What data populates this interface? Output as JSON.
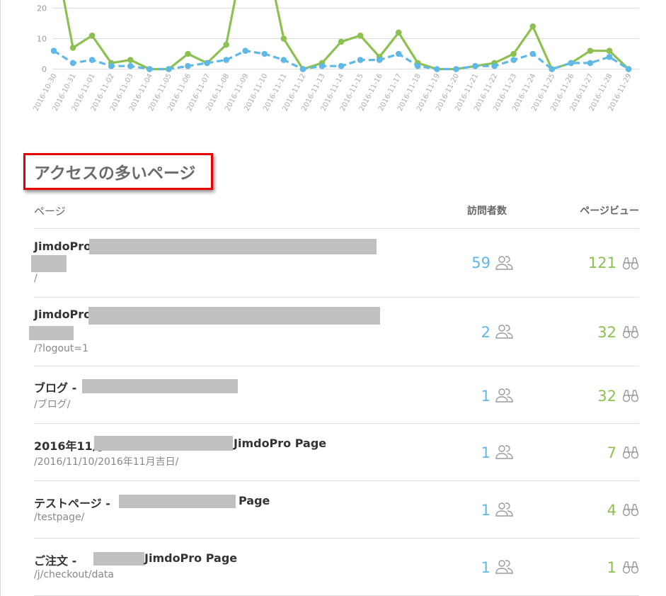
{
  "chart_data": {
    "type": "line",
    "categories": [
      "2016-10-30",
      "2016-10-31",
      "2016-11-01",
      "2016-11-02",
      "2016-11-03",
      "2016-11-04",
      "2016-11-05",
      "2016-11-06",
      "2016-11-07",
      "2016-11-08",
      "2016-11-09",
      "2016-11-10",
      "2016-11-11",
      "2016-11-12",
      "2016-11-13",
      "2016-11-14",
      "2016-11-15",
      "2016-11-16",
      "2016-11-17",
      "2016-11-18",
      "2016-11-19",
      "2016-11-20",
      "2016-11-21",
      "2016-11-22",
      "2016-11-23",
      "2016-11-24",
      "2016-11-25",
      "2016-11-26",
      "2016-11-27",
      "2016-11-28",
      "2016-11-29"
    ],
    "y_ticks": [
      "0",
      "10",
      "20"
    ],
    "ylim": [
      0,
      23
    ],
    "series": [
      {
        "color": "#8cc152",
        "dashed": false,
        "values": [
          40,
          7,
          11,
          2,
          3,
          0,
          0,
          5,
          2,
          8,
          40,
          40,
          10,
          0,
          2,
          9,
          11,
          4,
          12,
          2,
          0,
          0,
          1,
          2,
          5,
          14,
          0,
          2,
          6,
          6,
          0
        ]
      },
      {
        "color": "#5fb8e6",
        "dashed": true,
        "values": [
          6,
          2,
          3,
          1,
          1,
          0,
          0,
          1,
          2,
          3,
          6,
          5,
          3,
          0,
          1,
          1,
          3,
          3,
          5,
          1,
          0,
          0,
          1,
          1,
          3,
          5,
          0,
          2,
          2,
          4,
          0
        ]
      }
    ]
  },
  "section": {
    "title": "アクセスの多いページ"
  },
  "table": {
    "headers": {
      "page": "ページ",
      "visitors": "訪問者数",
      "views": "ページビュー"
    },
    "rows": [
      {
        "title": "JimdoPro",
        "path": "/",
        "visitors": "59",
        "views": "121"
      },
      {
        "title": "JimdoPro",
        "path": "/?logout=1",
        "visitors": "2",
        "views": "32"
      },
      {
        "title": "ブログ -",
        "path": "/ブログ/",
        "visitors": "1",
        "views": "32"
      },
      {
        "title": "2016年11月",
        "title_suffix": "JimdoPro Page",
        "path": "/2016/11/10/2016年11月吉日/",
        "visitors": "1",
        "views": "7"
      },
      {
        "title": "テストページ -",
        "title_suffix": "Page",
        "path": "/testpage/",
        "visitors": "1",
        "views": "4"
      },
      {
        "title": "ご注文 -",
        "title_suffix": "JimdoPro Page",
        "path": "/j/checkout/data",
        "visitors": "1",
        "views": "1"
      }
    ]
  },
  "colors": {
    "visitors": "#5fb8e6",
    "views": "#8cc152",
    "highlight_border": "#e60000"
  }
}
